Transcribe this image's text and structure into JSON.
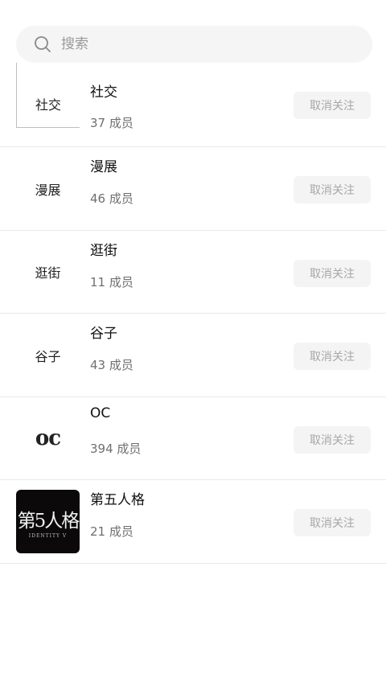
{
  "search": {
    "placeholder": "搜索"
  },
  "groups": [
    {
      "thumb_text": "社交",
      "name": "社交",
      "members": "37 成员",
      "action": "取消关注"
    },
    {
      "thumb_text": "漫展",
      "name": "漫展",
      "members": "46 成员",
      "action": "取消关注"
    },
    {
      "thumb_text": "逛街",
      "name": "逛街",
      "members": "11 成员",
      "action": "取消关注"
    },
    {
      "thumb_text": "谷子",
      "name": "谷子",
      "members": "43 成员",
      "action": "取消关注"
    },
    {
      "thumb_text": "oc",
      "name": "OC",
      "members": "394 成员",
      "action": "取消关注"
    },
    {
      "thumb_text": "第5人格",
      "thumb_sub": "IDENTITY V",
      "name": "第五人格",
      "members": "21 成员",
      "action": "取消关注"
    }
  ],
  "colors": {
    "search_bg": "#f5f5f5",
    "button_bg": "#f4f4f4",
    "button_text": "#a7a7a7",
    "divider": "#e9e9e9"
  }
}
